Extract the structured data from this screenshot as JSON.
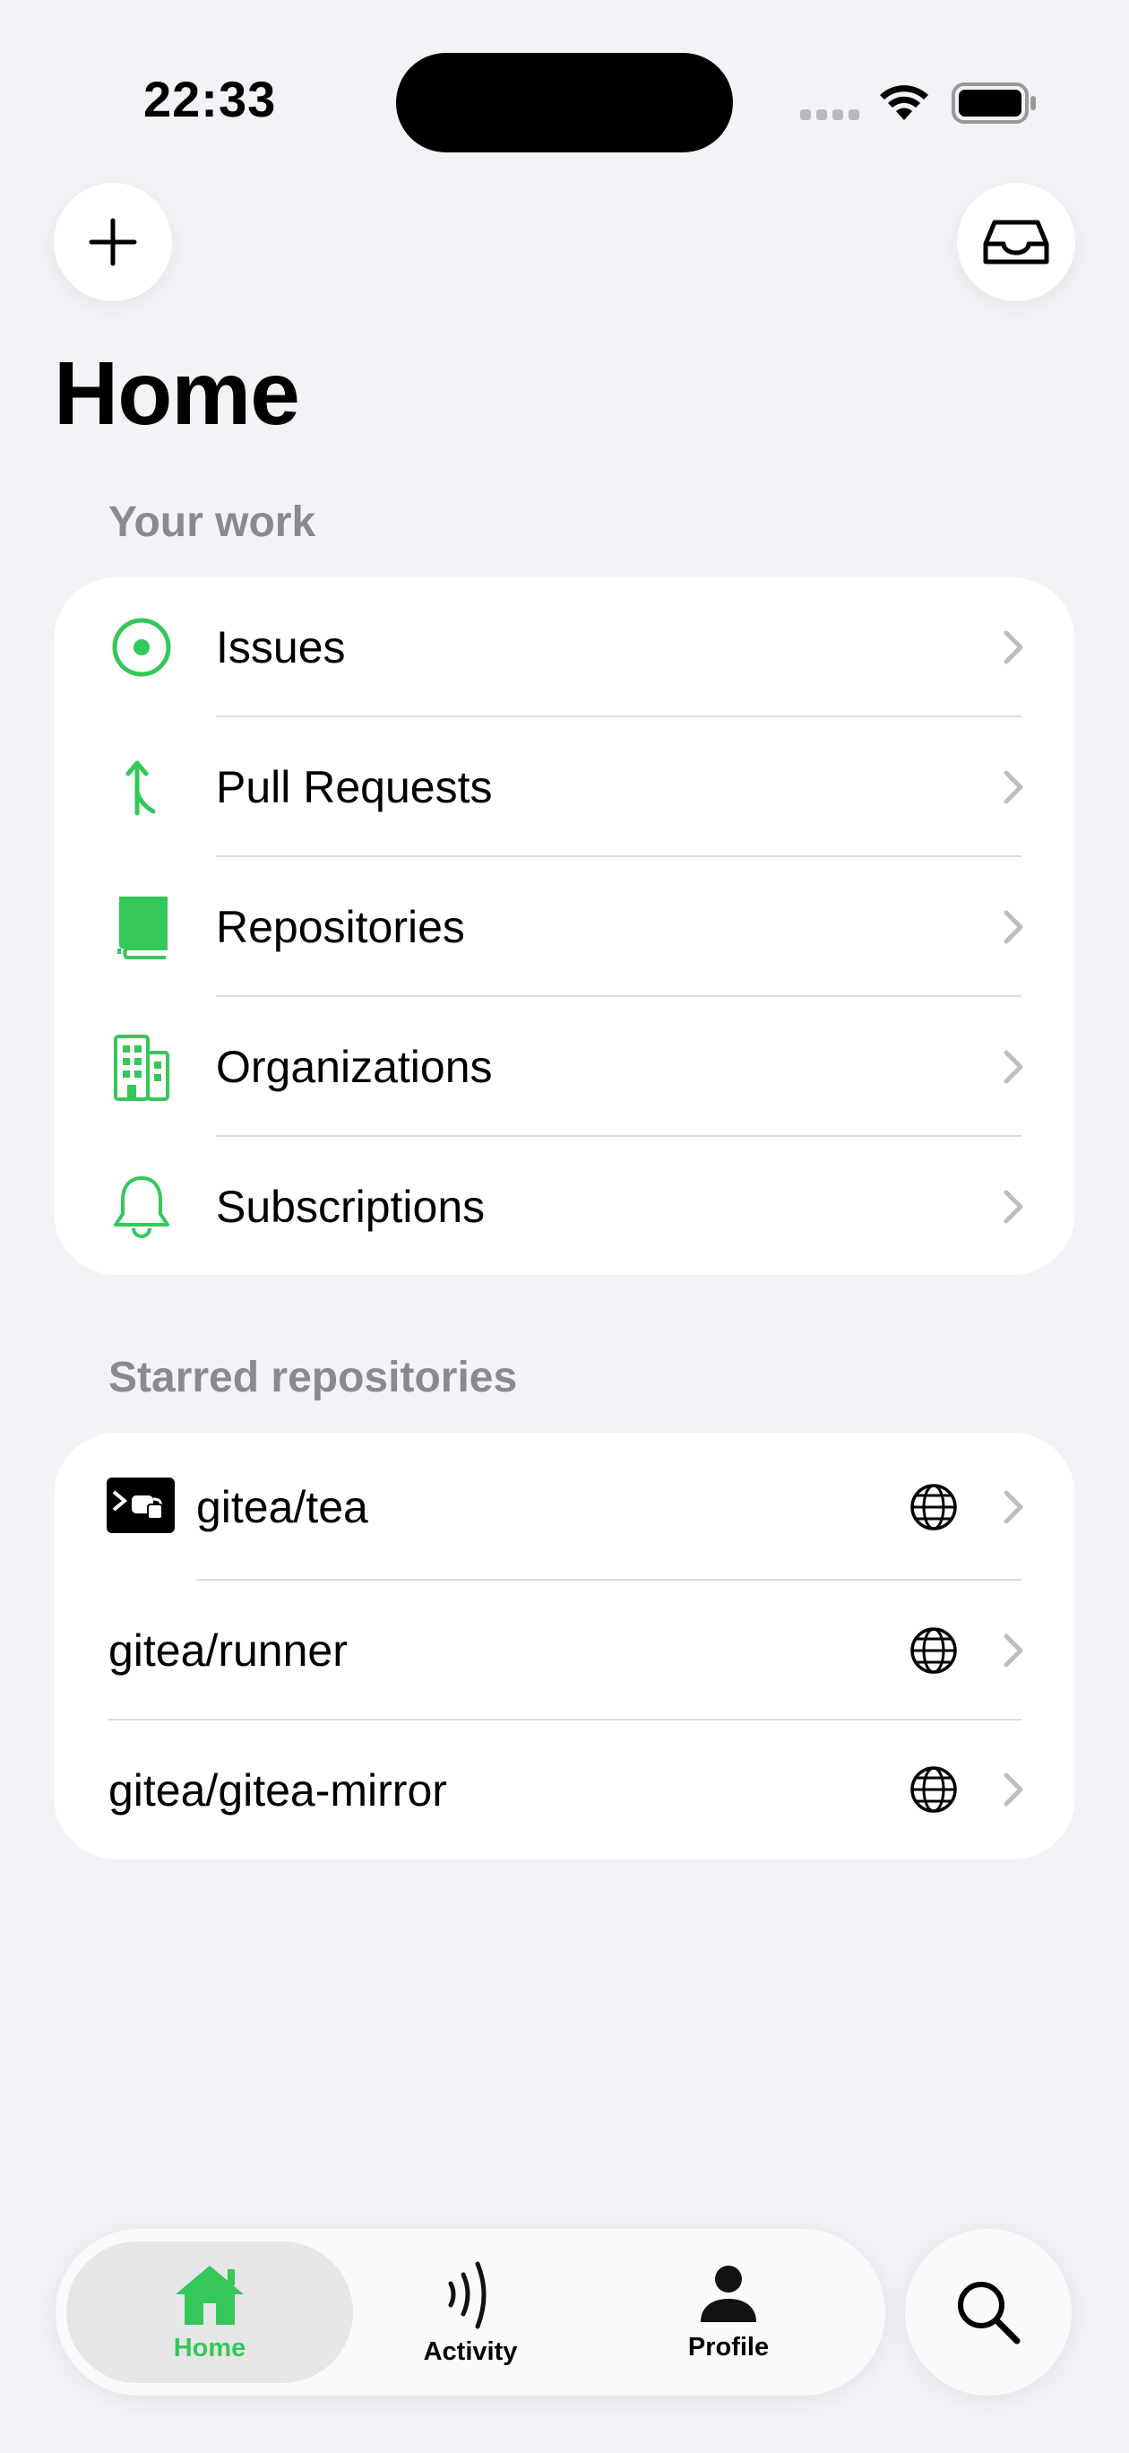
{
  "status_bar": {
    "time": "22:33"
  },
  "page": {
    "title": "Home"
  },
  "your_work": {
    "header": "Your work",
    "items": [
      {
        "label": "Issues",
        "icon": "issue-circle-icon"
      },
      {
        "label": "Pull Requests",
        "icon": "pull-request-icon"
      },
      {
        "label": "Repositories",
        "icon": "book-icon"
      },
      {
        "label": "Organizations",
        "icon": "building-icon"
      },
      {
        "label": "Subscriptions",
        "icon": "bell-icon"
      }
    ]
  },
  "starred": {
    "header": "Starred repositories",
    "items": [
      {
        "label": "gitea/tea",
        "icon": "repo-avatar",
        "visibility": "globe-icon"
      },
      {
        "label": "gitea/runner",
        "visibility": "globe-icon"
      },
      {
        "label": "gitea/gitea-mirror",
        "visibility": "globe-icon"
      }
    ]
  },
  "tabbar": {
    "tabs": [
      {
        "label": "Home",
        "icon": "house-icon",
        "selected": true
      },
      {
        "label": "Activity",
        "icon": "activity-waves-icon",
        "selected": false
      },
      {
        "label": "Profile",
        "icon": "person-icon",
        "selected": false
      }
    ]
  },
  "colors": {
    "accent": "#34c759",
    "background": "#f2f2f7",
    "secondary_text": "#8a8a8e"
  }
}
